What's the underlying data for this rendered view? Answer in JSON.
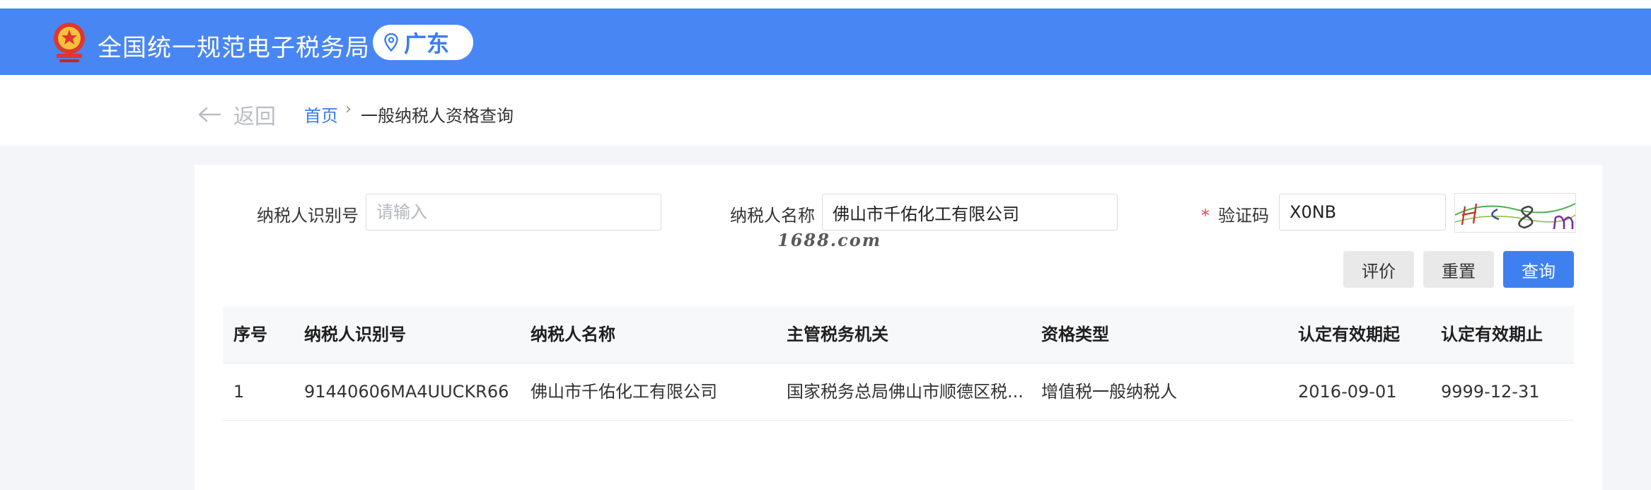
{
  "header": {
    "site_title": "全国统一规范电子税务局",
    "region": "广东",
    "brand_color": "#4886f3"
  },
  "subnav": {
    "back_label": "返回",
    "breadcrumb_home": "首页",
    "breadcrumb_sep": "›",
    "breadcrumb_current": "一般纳税人资格查询"
  },
  "form": {
    "taxpayer_id_label": "纳税人识别号",
    "taxpayer_id_placeholder": "请输入",
    "taxpayer_id_value": "",
    "taxpayer_name_label": "纳税人名称",
    "taxpayer_name_value": "佛山市千佑化工有限公司",
    "captcha_required_mark": "*",
    "captcha_label": "验证码",
    "captcha_value": "X0NB"
  },
  "watermark": "1688.com",
  "buttons": {
    "evaluate": "评价",
    "reset": "重置",
    "query": "查询"
  },
  "table": {
    "columns": [
      "序号",
      "纳税人识别号",
      "纳税人名称",
      "主管税务机关",
      "资格类型",
      "认定有效期起",
      "认定有效期止"
    ],
    "rows": [
      [
        "1",
        "91440606MA4UUCKR66",
        "佛山市千佑化工有限公司",
        "国家税务总局佛山市顺德区税...",
        "增值税一般纳税人",
        "2016-09-01",
        "9999-12-31"
      ]
    ]
  }
}
